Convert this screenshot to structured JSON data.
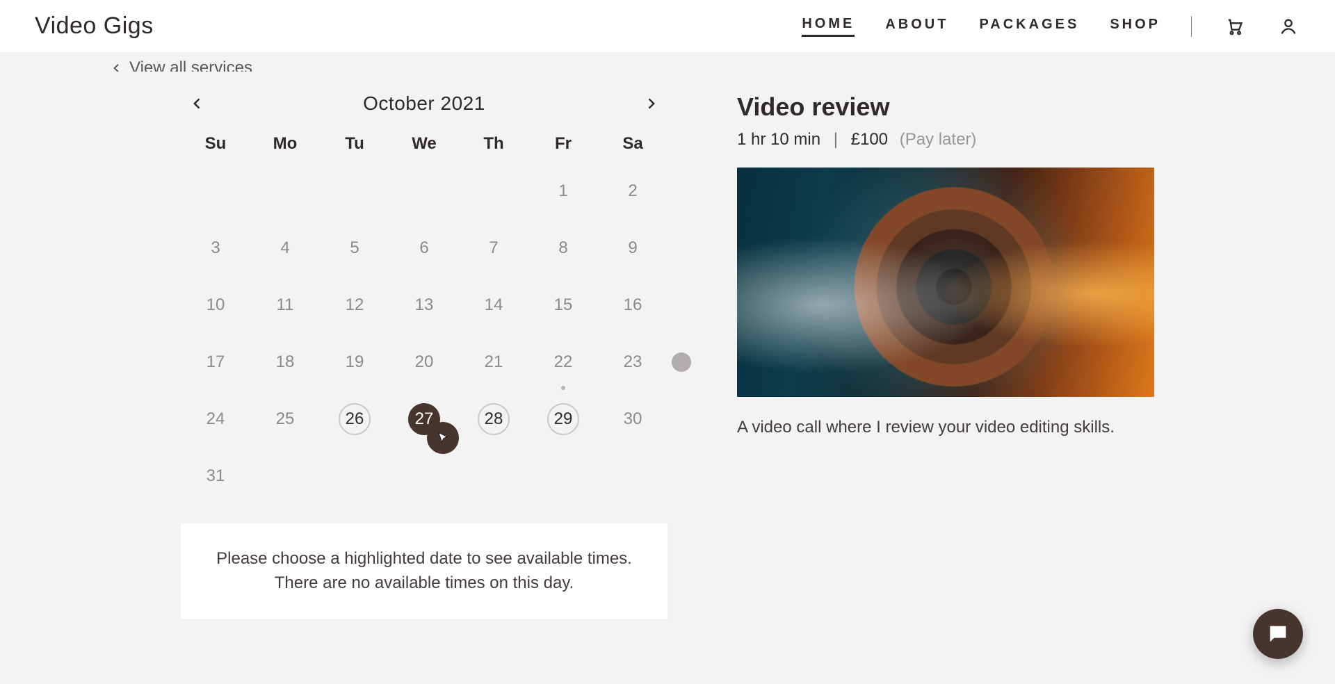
{
  "brand": "Video Gigs",
  "nav": {
    "items": [
      {
        "label": "HOME",
        "active": true
      },
      {
        "label": "ABOUT"
      },
      {
        "label": "PACKAGES"
      },
      {
        "label": "SHOP"
      }
    ]
  },
  "backlink": {
    "label": "View all services"
  },
  "calendar": {
    "title": "October 2021",
    "weekdays": [
      "Su",
      "Mo",
      "Tu",
      "We",
      "Th",
      "Fr",
      "Sa"
    ],
    "days": [
      {
        "n": "",
        "state": "blank"
      },
      {
        "n": "",
        "state": "blank"
      },
      {
        "n": "",
        "state": "blank"
      },
      {
        "n": "",
        "state": "blank"
      },
      {
        "n": "",
        "state": "blank"
      },
      {
        "n": "1",
        "state": "past"
      },
      {
        "n": "2",
        "state": "past"
      },
      {
        "n": "3",
        "state": "past"
      },
      {
        "n": "4",
        "state": "past"
      },
      {
        "n": "5",
        "state": "past"
      },
      {
        "n": "6",
        "state": "past"
      },
      {
        "n": "7",
        "state": "past"
      },
      {
        "n": "8",
        "state": "past"
      },
      {
        "n": "9",
        "state": "past"
      },
      {
        "n": "10",
        "state": "past"
      },
      {
        "n": "11",
        "state": "past"
      },
      {
        "n": "12",
        "state": "past"
      },
      {
        "n": "13",
        "state": "past"
      },
      {
        "n": "14",
        "state": "past"
      },
      {
        "n": "15",
        "state": "past"
      },
      {
        "n": "16",
        "state": "past"
      },
      {
        "n": "17",
        "state": "past"
      },
      {
        "n": "18",
        "state": "past"
      },
      {
        "n": "19",
        "state": "past"
      },
      {
        "n": "20",
        "state": "past"
      },
      {
        "n": "21",
        "state": "past"
      },
      {
        "n": "22",
        "state": "dot"
      },
      {
        "n": "23",
        "state": "bigdot"
      },
      {
        "n": "24",
        "state": "past"
      },
      {
        "n": "25",
        "state": "past"
      },
      {
        "n": "26",
        "state": "avail"
      },
      {
        "n": "27",
        "state": "selected"
      },
      {
        "n": "28",
        "state": "avail"
      },
      {
        "n": "29",
        "state": "avail"
      },
      {
        "n": "30",
        "state": "dim"
      },
      {
        "n": "31",
        "state": "dim"
      }
    ],
    "notice": "Please choose a highlighted date to see available times. There are no available times on this day."
  },
  "service": {
    "title": "Video review",
    "duration": "1 hr 10 min",
    "price": "£100",
    "pay_note": "(Pay later)",
    "description": "A video call where I review your video editing skills."
  }
}
